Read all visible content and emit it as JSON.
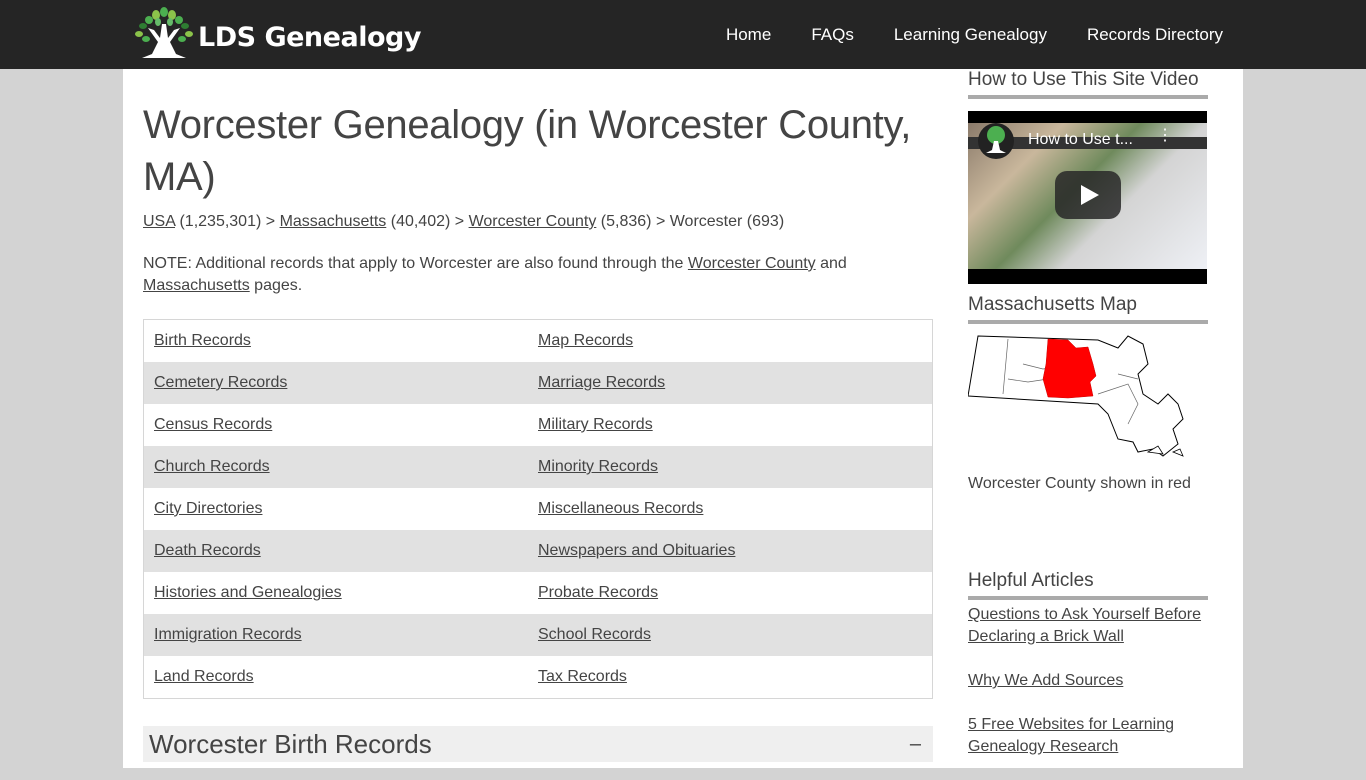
{
  "header": {
    "logo_text": "LDS Genealogy",
    "nav": [
      {
        "label": "Home"
      },
      {
        "label": "FAQs"
      },
      {
        "label": "Learning Genealogy"
      },
      {
        "label": "Records Directory"
      }
    ]
  },
  "main": {
    "title": "Worcester Genealogy (in Worcester County, MA)",
    "breadcrumb": [
      {
        "label": "USA",
        "count": "(1,235,301)",
        "link": true
      },
      {
        "label": "Massachusetts",
        "count": "(40,402)",
        "link": true
      },
      {
        "label": "Worcester County",
        "count": "(5,836)",
        "link": true
      },
      {
        "label": "Worcester",
        "count": "(693)",
        "link": false
      }
    ],
    "breadcrumb_separator": ">",
    "note": {
      "prefix": "NOTE: Additional records that apply to Worcester are also found through the",
      "link1": "Worcester County",
      "middle": "and",
      "link2": "Massachusetts",
      "suffix": "pages."
    },
    "record_rows": [
      [
        "Birth Records",
        "Map Records"
      ],
      [
        "Cemetery Records",
        "Marriage Records"
      ],
      [
        "Census Records",
        "Military Records"
      ],
      [
        "Church Records",
        "Minority Records"
      ],
      [
        "City Directories",
        "Miscellaneous Records"
      ],
      [
        "Death Records",
        "Newspapers and Obituaries"
      ],
      [
        "Histories and Genealogies",
        "Probate Records"
      ],
      [
        "Immigration Records",
        "School Records"
      ],
      [
        "Land Records",
        "Tax Records"
      ]
    ],
    "section": {
      "title": "Worcester Birth Records",
      "toggle": "–"
    }
  },
  "sidebar": {
    "video_heading": "How to Use This Site Video",
    "video_title": "How to Use t...",
    "map_heading": "Massachusetts Map",
    "map_caption": "Worcester County shown in red",
    "map_highlight_color": "#ff0000",
    "articles_heading": "Helpful Articles",
    "articles": [
      {
        "label": "Questions to Ask Yourself Before Declaring a Brick Wall"
      },
      {
        "label": "Why We Add Sources"
      },
      {
        "label": "5 Free Websites for Learning Genealogy Research"
      }
    ]
  },
  "colors": {
    "topbar": "#252525",
    "background": "#d3d3d3",
    "row_alt": "#e1e1e1",
    "text": "#444444",
    "logo_green": "#5cb85c"
  }
}
